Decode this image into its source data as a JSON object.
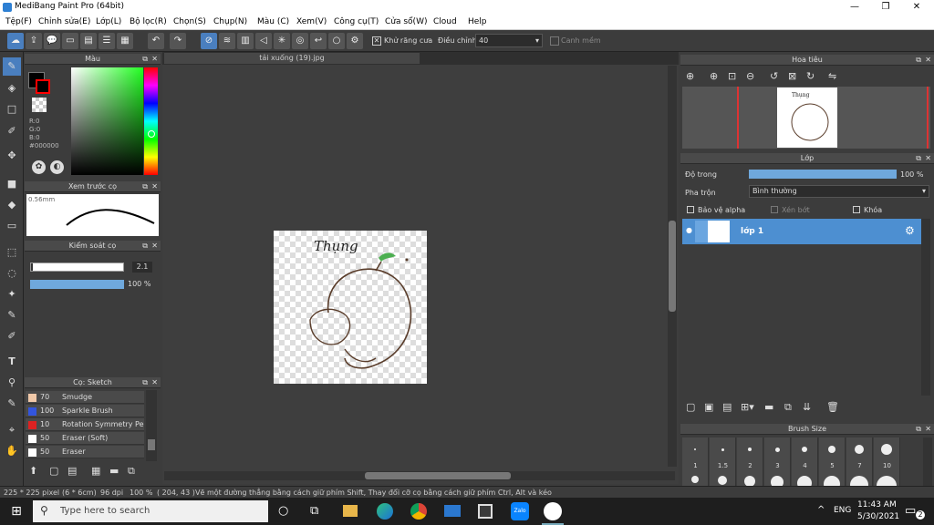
{
  "window": {
    "title": "MediBang Paint Pro (64bit)",
    "min": "—",
    "max": "❐",
    "close": "✕"
  },
  "menu": [
    "Tệp(F)",
    "Chỉnh sửa(E)",
    "Lớp(L)",
    "Bộ lọc(R)",
    "Chọn(S)",
    "Chụp(N)",
    "Màu (C)",
    "Xem(V)",
    "Công cụ(T)",
    "Cửa sổ(W)",
    "Cloud",
    "Help"
  ],
  "toolbar": {
    "antialias_label": "Khử răng cưa",
    "correction_label": "Điều chỉnh",
    "correction_value": "40",
    "snap_label": "Canh mềm"
  },
  "color_panel": {
    "title": "Màu",
    "r": "R:0",
    "g": "G:0",
    "b": "B:0",
    "hex": "#000000",
    "primary": "#ff0000",
    "secondary": "#000000"
  },
  "brush_preview": {
    "title": "Xem trước cọ",
    "size": "0.56mm"
  },
  "brush_control": {
    "title": "Kiểm soát cọ",
    "size_value": "2.1",
    "opacity_value": "100 %"
  },
  "brush_list": {
    "title": "Cọ: Sketch",
    "items": [
      {
        "size": "70",
        "name": "Smudge",
        "color": "#f0c8a8"
      },
      {
        "size": "100",
        "name": "Sparkle Brush",
        "color": "#3355dd"
      },
      {
        "size": "10",
        "name": "Rotation Symmetry Pe",
        "color": "#dd2222"
      },
      {
        "size": "50",
        "name": "Eraser (Soft)",
        "color": "#ffffff"
      },
      {
        "size": "50",
        "name": "Eraser",
        "color": "#ffffff"
      }
    ]
  },
  "document": {
    "tab": "tải xuống (19).jpg",
    "art_text": "Thụng"
  },
  "navigator": {
    "title": "Hoa tiêu"
  },
  "layer_panel": {
    "title": "Lớp",
    "opacity_label": "Độ trong",
    "opacity_value": "100 %",
    "blend_label": "Pha trộn",
    "blend_value": "Bình thường",
    "protect_alpha": "Bảo vệ alpha",
    "clipping": "Xén bớt",
    "lock": "Khóa",
    "layer_name": "lớp 1"
  },
  "brush_size_panel": {
    "title": "Brush Size",
    "sizes": [
      "1",
      "1.5",
      "2",
      "3",
      "4",
      "5",
      "7",
      "10"
    ]
  },
  "status": {
    "dims": "225 * 225 pixel",
    "phys": "(6 * 6cm)",
    "dpi": "96 dpi",
    "zoom": "100 %",
    "coords": "( 204, 43 )",
    "hint": "Vẽ một đường thẳng bằng cách giữ phím Shift, Thay đổi cỡ cọ bằng cách giữ phím Ctrl, Alt và kéo"
  },
  "taskbar": {
    "search": "Type here to search",
    "lang": "ENG",
    "time": "11:43 AM",
    "date": "5/30/2021",
    "notif": "2"
  }
}
